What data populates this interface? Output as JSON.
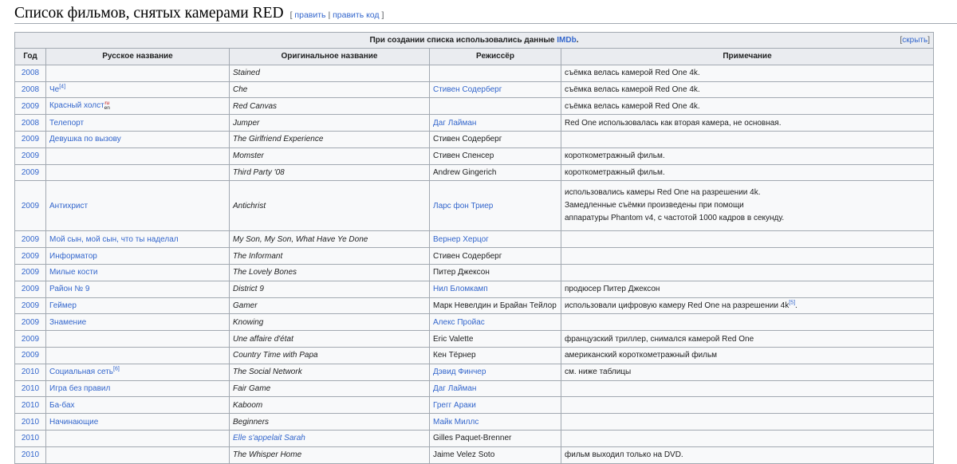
{
  "heading": {
    "title": "Список фильмов, снятых камерами RED",
    "edit_label": "править",
    "separator": "|",
    "edit_code_label": "править код"
  },
  "table": {
    "caption_text": "При создании списка использовались данные ",
    "caption_link": "IMDb",
    "caption_end": ".",
    "hide_label": "скрыть",
    "columns": [
      "Год",
      "Русское название",
      "Оригинальное название",
      "Режиссёр",
      "Примечание"
    ],
    "rows": [
      {
        "year": "2008",
        "ru": "",
        "orig": "Stained",
        "director": "",
        "note": "съёмка велась камерой Red One 4k."
      },
      {
        "year": "2008",
        "ru": "Че",
        "ru_sup": "[4]",
        "orig": "Che",
        "director": "Стивен Содерберг",
        "note": "съёмка велась камерой Red One 4k."
      },
      {
        "year": "2009",
        "ru": "Красный холст",
        "lang_ru": "ru",
        "lang_en": "en",
        "orig": "Red Canvas",
        "director": "",
        "note": "съёмка велась камерой Red One 4k."
      },
      {
        "year": "2008",
        "ru": "Телепорт",
        "orig": "Jumper",
        "director": "Даг Лайман",
        "note": "Red One использовалась как вторая камера, не основная."
      },
      {
        "year": "2009",
        "ru": "Девушка по вызову",
        "orig": "The Girlfriend Experience",
        "director": "Стивен Содерберг",
        "note": ""
      },
      {
        "year": "2009",
        "ru": "",
        "orig": "Momster",
        "director": "Стивен Спенсер",
        "note": "короткометражный фильм."
      },
      {
        "year": "2009",
        "ru": "",
        "orig": "Third Party '08",
        "director": "Andrew Gingerich",
        "note": "короткометражный фильм."
      },
      {
        "year": "2009",
        "ru": "Антихрист",
        "orig": "Antichrist",
        "director": "Ларс фон Триер",
        "note_lines": [
          "использовались камеры Red One на разрешении 4k.",
          "Замедленные съёмки произведены при помощи",
          "аппаратуры Phantom v4, с частотой 1000 кадров в секунду."
        ]
      },
      {
        "year": "2009",
        "ru": "Мой сын, мой сын, что ты наделал",
        "orig": "My Son, My Son, What Have Ye Done",
        "director": "Вернер Херцог",
        "note": ""
      },
      {
        "year": "2009",
        "ru": "Информатор",
        "orig": "The Informant",
        "director": "Стивен Содерберг",
        "note": ""
      },
      {
        "year": "2009",
        "ru": "Милые кости",
        "orig": "The Lovely Bones",
        "director": "Питер Джексон",
        "note": ""
      },
      {
        "year": "2009",
        "ru": "Район № 9",
        "orig": "District 9",
        "director": "Нил Бломкамп",
        "note": "продюсер Питер Джексон"
      },
      {
        "year": "2009",
        "ru": "Геймер",
        "orig": "Gamer",
        "director": "Марк Невелдин и Брайан Тейлор",
        "note": "использовали цифровую камеру Red One на разрешении 4k",
        "note_sup": "[5]",
        "note_end": "."
      },
      {
        "year": "2009",
        "ru": "Знамение",
        "orig": "Knowing",
        "director": "Алекс Пройас",
        "note": ""
      },
      {
        "year": "2009",
        "ru": "",
        "orig": "Une affaire d'état",
        "director": "Eric Valette",
        "note": "французский триллер, снимался камерой Red One"
      },
      {
        "year": "2009",
        "ru": "",
        "orig": "Country Time with Papa",
        "director": "Кен Тёрнер",
        "note": "американский короткометражный фильм"
      },
      {
        "year": "2010",
        "ru": "Социальная сеть",
        "ru_sup": "[6]",
        "orig": "The Social Network",
        "director": "Дэвид Финчер",
        "note": "см. ниже таблицы"
      },
      {
        "year": "2010",
        "ru": "Игра без правил",
        "orig": "Fair Game",
        "director": "Даг Лайман",
        "note": ""
      },
      {
        "year": "2010",
        "ru": "Ба-бах",
        "orig": "Kaboom",
        "director": "Грегг Араки",
        "note": ""
      },
      {
        "year": "2010",
        "ru": "Начинающие",
        "orig": "Beginners",
        "director": "Майк Миллс",
        "note": ""
      },
      {
        "year": "2010",
        "ru": "",
        "orig": "Elle s'appelait Sarah",
        "director": "Gilles Paquet-Brenner",
        "note": ""
      },
      {
        "year": "2010",
        "ru": "",
        "orig": "The Whisper Home",
        "director": "Jaime Velez Soto",
        "note": "фильм выходил только на DVD."
      }
    ]
  },
  "colors": {
    "link": "#3366cc",
    "header_bg": "#eaecf0",
    "cell_bg": "#f8f9fa",
    "border": "#a2a9b1",
    "red_link": "#ba0000"
  }
}
